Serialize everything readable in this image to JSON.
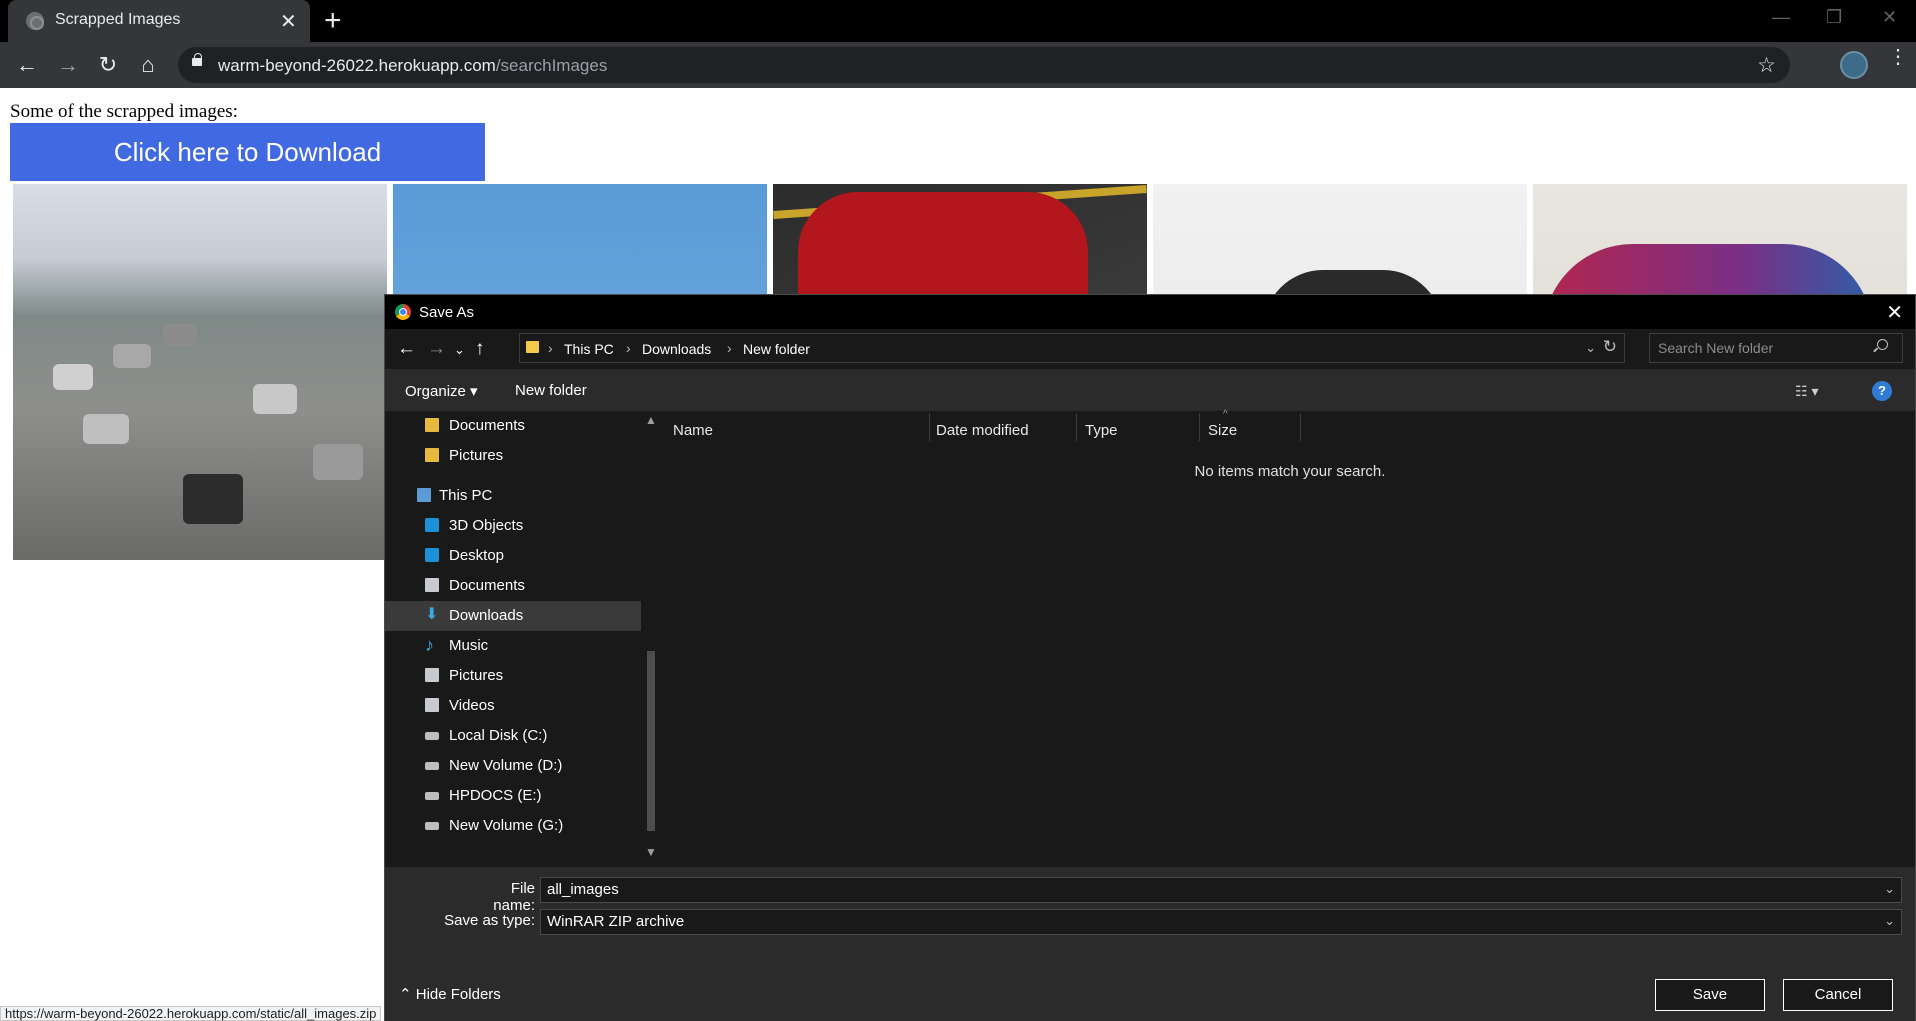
{
  "browser": {
    "tab_title": "Scrapped Images",
    "url_host": "warm-beyond-26022.herokuapp.com",
    "url_path": "/searchImages",
    "status_url": "https://warm-beyond-26022.herokuapp.com/static/all_images.zip"
  },
  "page": {
    "intro_text": "Some of the scrapped images:",
    "download_button": "Click here to Download"
  },
  "dialog": {
    "title": "Save As",
    "breadcrumb": [
      "This PC",
      "Downloads",
      "New folder"
    ],
    "search_placeholder": "Search New folder",
    "toolbar": {
      "organize": "Organize ▾",
      "new_folder": "New folder"
    },
    "nav_items": [
      {
        "label": "Documents",
        "icon": "folder-icon"
      },
      {
        "label": "Pictures",
        "icon": "folder-icon"
      },
      {
        "label": "This PC",
        "icon": "computer-icon"
      },
      {
        "label": "3D Objects",
        "icon": "cube-icon"
      },
      {
        "label": "Desktop",
        "icon": "desktop-icon"
      },
      {
        "label": "Documents",
        "icon": "documents-icon"
      },
      {
        "label": "Downloads",
        "icon": "download-icon",
        "selected": true
      },
      {
        "label": "Music",
        "icon": "music-icon"
      },
      {
        "label": "Pictures",
        "icon": "pictures-icon"
      },
      {
        "label": "Videos",
        "icon": "videos-icon"
      },
      {
        "label": "Local Disk (C:)",
        "icon": "drive-icon"
      },
      {
        "label": "New Volume (D:)",
        "icon": "drive-icon"
      },
      {
        "label": "HPDOCS (E:)",
        "icon": "drive-icon"
      },
      {
        "label": "New Volume (G:)",
        "icon": "drive-icon"
      }
    ],
    "columns": [
      "Name",
      "Date modified",
      "Type",
      "Size"
    ],
    "empty_message": "No items match your search.",
    "file_name_label": "File name:",
    "file_name_value": "all_images",
    "save_type_label": "Save as type:",
    "save_type_value": "WinRAR ZIP archive",
    "hide_folders": "Hide Folders",
    "save_button": "Save",
    "cancel_button": "Cancel"
  }
}
